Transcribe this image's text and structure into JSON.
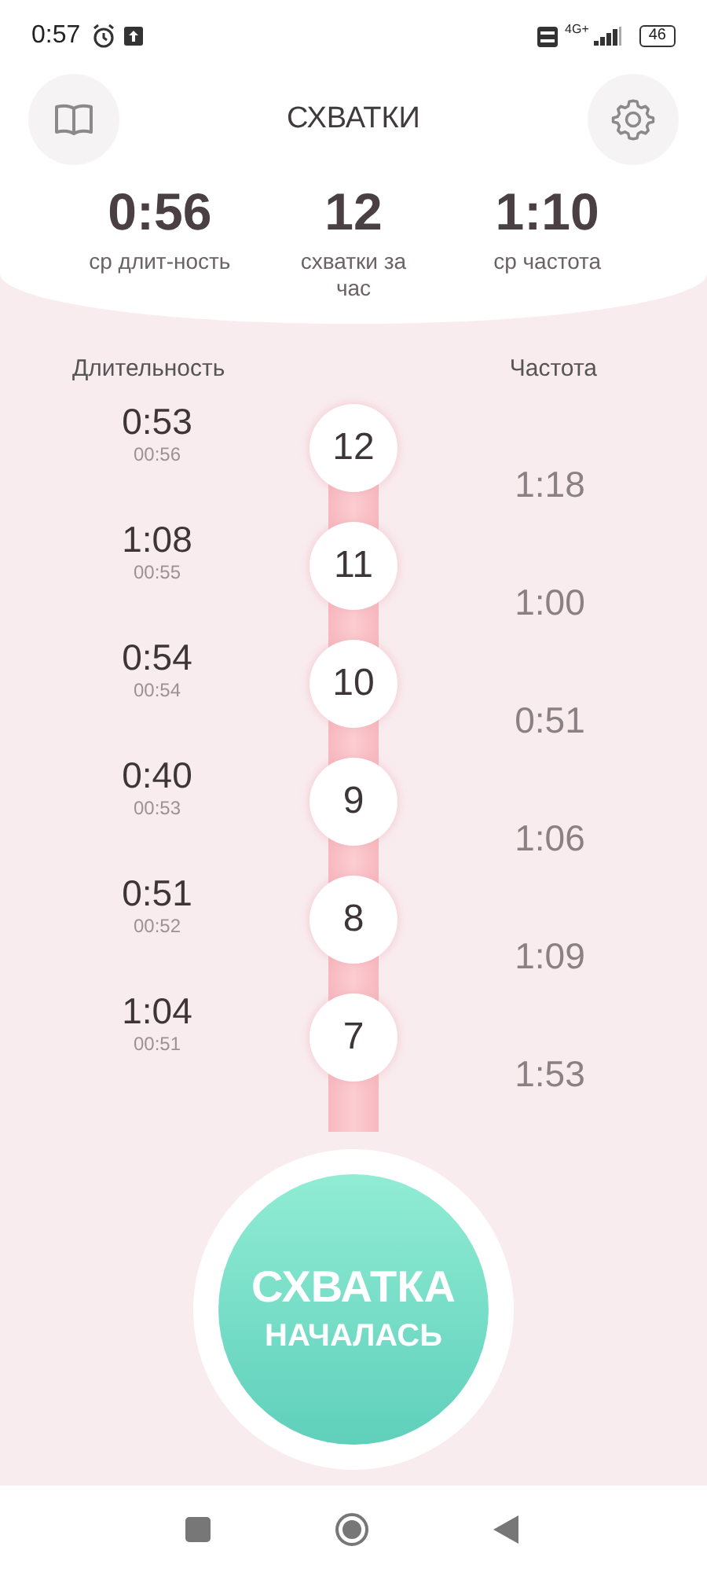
{
  "status_bar": {
    "time": "0:57",
    "network": "4G+",
    "battery": "46"
  },
  "header": {
    "title": "СХВАТКИ"
  },
  "stats": [
    {
      "value": "0:56",
      "label": "ср длит-ность"
    },
    {
      "value": "12",
      "label": "схватки за час"
    },
    {
      "value": "1:10",
      "label": "ср частота"
    }
  ],
  "columns": {
    "duration": "Длительность",
    "frequency": "Частота"
  },
  "contractions": [
    {
      "number": "12",
      "duration": "0:53",
      "average": "00:56"
    },
    {
      "number": "11",
      "duration": "1:08",
      "average": "00:55"
    },
    {
      "number": "10",
      "duration": "0:54",
      "average": "00:54"
    },
    {
      "number": "9",
      "duration": "0:40",
      "average": "00:53"
    },
    {
      "number": "8",
      "duration": "0:51",
      "average": "00:52"
    },
    {
      "number": "7",
      "duration": "1:04",
      "average": "00:51"
    }
  ],
  "frequencies": [
    "1:18",
    "1:00",
    "0:51",
    "1:06",
    "1:09",
    "1:53"
  ],
  "start_button": {
    "line_1": "СХВАТКА",
    "line_2": "НАЧАЛАСЬ"
  }
}
